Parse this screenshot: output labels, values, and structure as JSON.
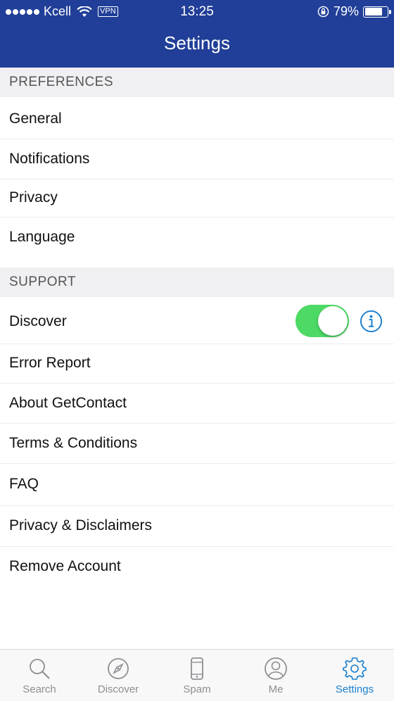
{
  "status_bar": {
    "carrier": "Kcell",
    "vpn": "VPN",
    "time": "13:25",
    "battery": "79%",
    "battery_level": 0.79
  },
  "header": {
    "title": "Settings"
  },
  "sections": [
    {
      "title": "PREFERENCES",
      "items": [
        "General",
        "Notifications",
        "Privacy",
        "Language"
      ]
    },
    {
      "title": "SUPPORT",
      "items": [
        "Discover",
        "Error Report",
        "About GetContact",
        "Terms & Conditions",
        "FAQ",
        "Privacy & Disclaimers",
        "Remove Account"
      ]
    }
  ],
  "discover_toggle": {
    "on": true
  },
  "tabs": [
    {
      "label": "Search",
      "icon": "search-icon"
    },
    {
      "label": "Discover",
      "icon": "compass-icon"
    },
    {
      "label": "Spam",
      "icon": "phone-icon"
    },
    {
      "label": "Me",
      "icon": "user-icon"
    },
    {
      "label": "Settings",
      "icon": "gear-icon",
      "active": true
    }
  ],
  "colors": {
    "header": "#213f98",
    "toggle_on": "#4cd964",
    "active_tab": "#1a7fd0",
    "inactive_tab": "#8e8e93"
  }
}
